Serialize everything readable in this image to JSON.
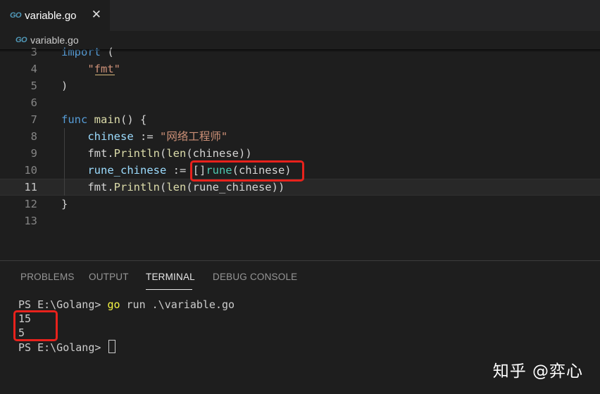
{
  "tab": {
    "icon": "go-file-icon",
    "icon_text": "GO",
    "label": "variable.go",
    "close": "✕"
  },
  "breadcrumb": {
    "icon_text": "GO",
    "label": "variable.go"
  },
  "editor": {
    "lines": [
      {
        "n": "3",
        "tokens": [
          [
            "kw",
            "import"
          ],
          [
            "pl",
            " ("
          ]
        ]
      },
      {
        "n": "4",
        "tokens": [
          [
            "pl",
            "    "
          ],
          [
            "str",
            "\"fmt\""
          ]
        ]
      },
      {
        "n": "5",
        "tokens": [
          [
            "pl",
            ")"
          ]
        ]
      },
      {
        "n": "6",
        "tokens": []
      },
      {
        "n": "7",
        "tokens": [
          [
            "kw",
            "func"
          ],
          [
            "pl",
            " "
          ],
          [
            "fn",
            "main"
          ],
          [
            "pl",
            "() {"
          ]
        ]
      },
      {
        "n": "8",
        "tokens": [
          [
            "pl",
            "    "
          ],
          [
            "var",
            "chinese"
          ],
          [
            "pl",
            " := "
          ],
          [
            "str",
            "\"网络工程师\""
          ]
        ]
      },
      {
        "n": "9",
        "tokens": [
          [
            "pl",
            "    fmt."
          ],
          [
            "fn",
            "Println"
          ],
          [
            "pl",
            "("
          ],
          [
            "fn",
            "len"
          ],
          [
            "pl",
            "(chinese))"
          ]
        ]
      },
      {
        "n": "10",
        "tokens": [
          [
            "pl",
            "    "
          ],
          [
            "var",
            "rune_chinese"
          ],
          [
            "pl",
            " := "
          ],
          [
            "pl",
            "[]"
          ],
          [
            "ty",
            "rune"
          ],
          [
            "pl",
            "(chinese)"
          ]
        ]
      },
      {
        "n": "11",
        "tokens": [
          [
            "pl",
            "    fmt."
          ],
          [
            "fn",
            "Println"
          ],
          [
            "pl",
            "("
          ],
          [
            "fn",
            "len"
          ],
          [
            "pl",
            "(rune_chinese))"
          ]
        ]
      },
      {
        "n": "12",
        "tokens": [
          [
            "pl",
            "}"
          ]
        ]
      },
      {
        "n": "13",
        "tokens": []
      }
    ],
    "current_line": "11"
  },
  "panel": {
    "tabs": [
      "PROBLEMS",
      "OUTPUT",
      "TERMINAL",
      "DEBUG CONSOLE"
    ],
    "active_tab": "TERMINAL"
  },
  "terminal": {
    "prompt1": "PS E:\\Golang> ",
    "cmd": "go",
    "args": " run .\\variable.go",
    "out1": "15",
    "out2": "5",
    "prompt2": "PS E:\\Golang> "
  },
  "watermark": "知乎 @弈心",
  "colors": {
    "highlight_box": "#e8221c",
    "editor_bg": "#1e1e1e"
  }
}
